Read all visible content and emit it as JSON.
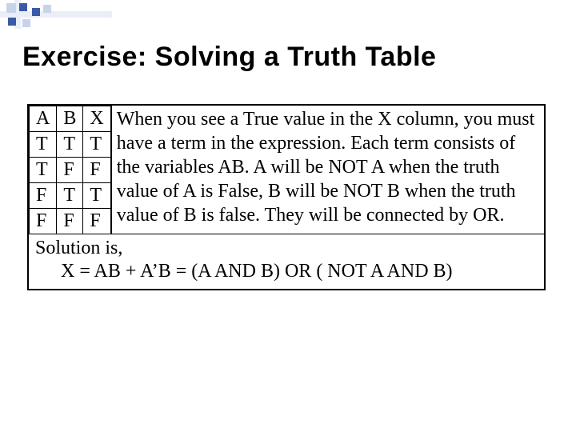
{
  "title": "Exercise:  Solving a Truth Table",
  "table": {
    "headers": [
      "A",
      "B",
      "X"
    ],
    "rows": [
      [
        "T",
        "T",
        "T"
      ],
      [
        "T",
        "F",
        "F"
      ],
      [
        "F",
        "T",
        "T"
      ],
      [
        "F",
        "F",
        "F"
      ]
    ]
  },
  "explanation": "When you see a True value in the X column, you must have a term in the expression.  Each term consists of the variables AB.  A will be NOT A when the truth value of A is False, B will be NOT B when the truth value of B is false.  They will be connected by OR.",
  "solution": {
    "label": "Solution is,",
    "equation": "X = AB + A’B = (A AND B) OR ( NOT A AND B)"
  }
}
